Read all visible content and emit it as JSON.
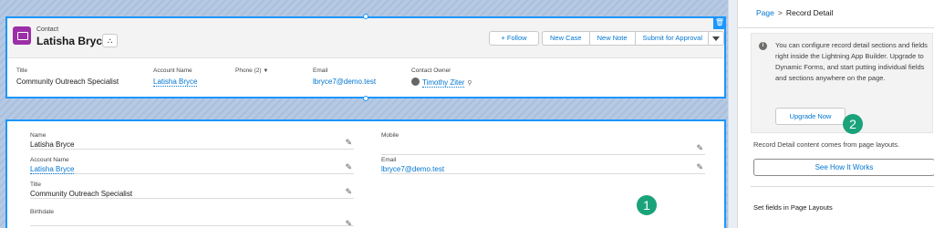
{
  "record": {
    "type_label": "Contact",
    "name": "Latisha Bryce",
    "hierarchy_icon": "⛬"
  },
  "actions": {
    "follow": "+ Follow",
    "buttons": [
      "New Case",
      "New Note",
      "Submit for Approval"
    ],
    "corner_icon": "🗑"
  },
  "highlights": {
    "title_label": "Title",
    "title_value": "Community Outreach Specialist",
    "account_label": "Account Name",
    "account_value": "Latisha Bryce",
    "phone_label": "Phone (2)",
    "phone_caret": "▼",
    "email_label": "Email",
    "email_value": "lbryce7@demo.test",
    "owner_label": "Contact Owner",
    "owner_value": "Timothy Ziter",
    "owner_icon": "⚲"
  },
  "detail": {
    "edit_icon": "✎",
    "fields": [
      {
        "label": "Name",
        "value": "Latisha Bryce"
      },
      {
        "label": "Account Name",
        "value": "Latisha Bryce"
      },
      {
        "label": "Title",
        "value": "Community Outreach Specialist"
      },
      {
        "label": "Birthdate",
        "value": ""
      },
      {
        "label": "Mobile",
        "value": ""
      },
      {
        "label": "Email",
        "value": "lbryce7@demo.test"
      }
    ]
  },
  "badges": {
    "one": "1",
    "two": "2"
  },
  "panel": {
    "crumb_page": "Page",
    "crumb_sep": ">",
    "crumb_current": "Record Detail",
    "info_icon": "i",
    "info_text": "You can configure record detail sections and fields right inside the Lightning App Builder. Upgrade to Dynamic Forms, and start putting individual fields and sections anywhere on the page.",
    "upgrade_label": "Upgrade Now",
    "note": "Record Detail content comes from page layouts.",
    "see_label": "See How It Works",
    "set_fields": "Set fields in Page Layouts"
  },
  "colors": {
    "accent": "#1b96ff",
    "brand": "#0176d3",
    "contact_icon": "#9b2fa7",
    "badge": "#1aa37a"
  }
}
